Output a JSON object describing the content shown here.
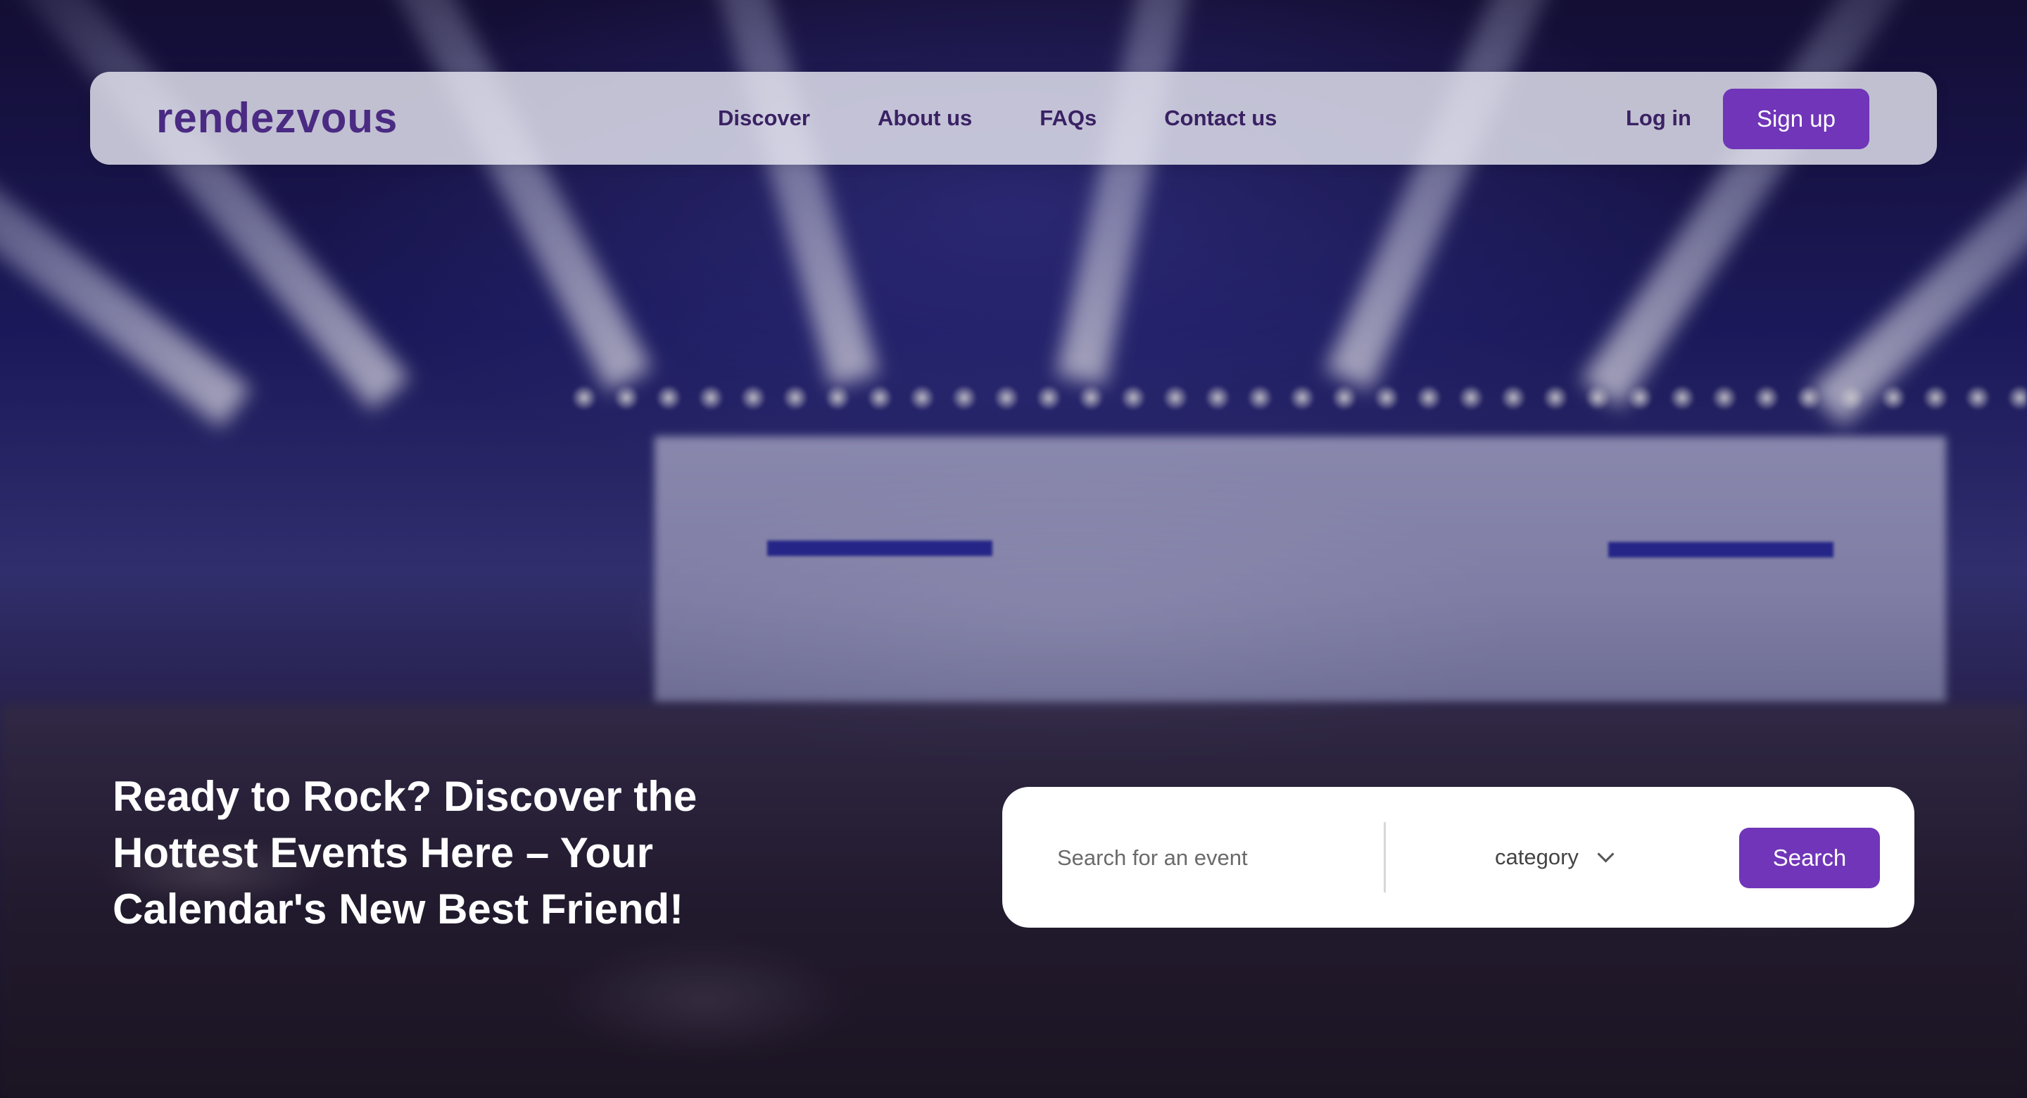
{
  "brand": {
    "logo_text": "rendezvous"
  },
  "nav": {
    "links": [
      "Discover",
      "About us",
      "FAQs",
      "Contact us"
    ],
    "login_label": "Log in",
    "signup_label": "Sign up"
  },
  "hero": {
    "headline": "Ready to Rock? Discover the Hottest Events Here – Your Calendar's New Best Friend!"
  },
  "search": {
    "placeholder": "Search for an event",
    "value": "",
    "category_label": "category",
    "button_label": "Search"
  },
  "colors": {
    "accent": "#7035b8",
    "nav_text": "#3a2163",
    "logo": "#4a2a82"
  },
  "icons": {
    "category_dropdown": "chevron-down-icon"
  }
}
